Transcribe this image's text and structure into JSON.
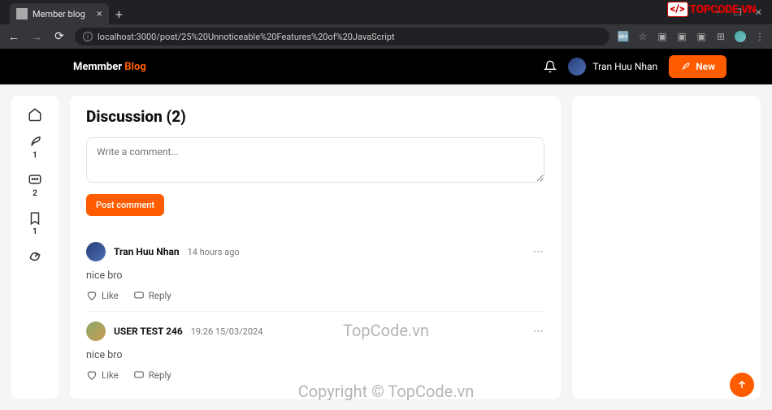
{
  "browser": {
    "tab_title": "Member blog",
    "url": "localhost:3000/post/25%20Unnoticeable%20Features%20of%20JavaScript"
  },
  "watermark": {
    "logo_text": "TOPCODE.VN",
    "center1": "TopCode.vn",
    "center2": "Copyright © TopCode.vn"
  },
  "header": {
    "logo_a": "Memmber ",
    "logo_b": "Blog",
    "user_name": "Tran Huu Nhan",
    "new_label": "New"
  },
  "rail": {
    "counts": {
      "pen": "1",
      "chat": "2",
      "bookmark": "1"
    }
  },
  "discussion": {
    "title": "Discussion (2)",
    "placeholder": "Write a comment...",
    "post_label": "Post comment",
    "like_label": "Like",
    "reply_label": "Reply",
    "comments": [
      {
        "name": "Tran Huu Nhan",
        "time": "14 hours ago",
        "body": "nice bro"
      },
      {
        "name": "USER TEST 246",
        "time": "19:26 15/03/2024",
        "body": "nice bro"
      }
    ]
  }
}
